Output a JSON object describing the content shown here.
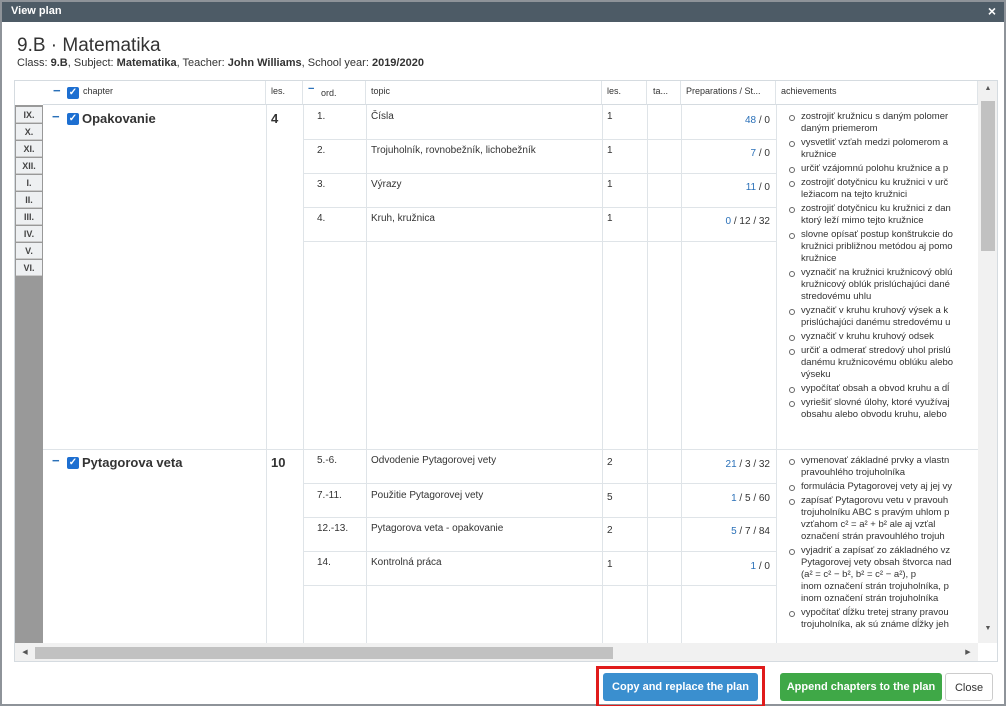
{
  "window": {
    "title": "View plan",
    "close_glyph": "×"
  },
  "page": {
    "title": "9.B · Matematika",
    "meta": {
      "class_label": "Class: ",
      "class_value": "9.B",
      "subject_label": ", Subject: ",
      "subject_value": "Matematika",
      "teacher_label": ", Teacher: ",
      "teacher_value": "John Williams",
      "year_label": ", School year: ",
      "year_value": "2019/2020"
    }
  },
  "columns": {
    "chapter": "chapter",
    "les": "les.",
    "ord": "ord.",
    "topic": "topic",
    "les2": "les.",
    "ta": "ta...",
    "prep": "Preparations / St...",
    "ach": "achievements"
  },
  "grade_tabs": [
    "IX.",
    "X.",
    "XI.",
    "XII.",
    "I.",
    "II.",
    "III.",
    "IV.",
    "V.",
    "VI."
  ],
  "chapters": [
    {
      "name": "Opakovanie",
      "lessons": "4",
      "topics": [
        {
          "ord": "1.",
          "topic": "Čísla",
          "les": "1",
          "prep_link": "48",
          "prep_rest": " / 0"
        },
        {
          "ord": "2.",
          "topic": "Trojuholník, rovnobežník, lichobežník",
          "les": "1",
          "prep_link": "7",
          "prep_rest": " / 0"
        },
        {
          "ord": "3.",
          "topic": "Výrazy",
          "les": "1",
          "prep_link": "11",
          "prep_rest": " / 0"
        },
        {
          "ord": "4.",
          "topic": "Kruh, kružnica",
          "les": "1",
          "prep_link": "0",
          "prep_rest": " / 12 / 32"
        }
      ],
      "achievements": [
        "zostrojiť kružnicu s daným polomer",
        "daným priemerom",
        "vysvetliť vzťah medzi polomerom a",
        "kružnice",
        "určiť vzájomnú polohu kružnice a p",
        "zostrojiť dotyčnicu ku kružnici v urč",
        "ležiacom na tejto kružnici",
        "zostrojiť dotyčnicu ku kružnici z dan",
        "ktorý leží mimo tejto kružnice",
        "slovne opísať postup konštrukcie do",
        "kružnici približnou metódou aj pomo",
        "kružnice",
        "vyznačiť na kružnici kružnicový oblú",
        "kružnicový oblúk prislúchajúci dané",
        "stredovému uhlu",
        "vyznačiť v kruhu kruhový výsek a k",
        "prislúchajúci danému stredovému u",
        "vyznačiť v kruhu kruhový odsek",
        "určiť a odmerať stredový uhol prislú",
        "danému kružnicovému oblúku alebo",
        "výseku",
        "vypočítať obsah a obvod kruhu a dĺ",
        "vyriešiť slovné úlohy, ktoré využívaj",
        "obsahu alebo obvodu kruhu, alebo"
      ]
    },
    {
      "name": "Pytagorova veta",
      "lessons": "10",
      "topics": [
        {
          "ord": "5.-6.",
          "topic": "Odvodenie Pytagorovej vety",
          "les": "2",
          "prep_link": "21",
          "prep_rest": " / 3 / 32"
        },
        {
          "ord": "7.-11.",
          "topic": "Použitie Pytagorovej vety",
          "les": "5",
          "prep_link": "1",
          "prep_rest": " / 5 / 60"
        },
        {
          "ord": "12.-13.",
          "topic": "Pytagorova veta - opakovanie",
          "les": "2",
          "prep_link": "5",
          "prep_rest": " / 7 / 84"
        },
        {
          "ord": "14.",
          "topic": "Kontrolná práca",
          "les": "1",
          "prep_link": "1",
          "prep_rest": " / 0"
        }
      ],
      "achievements": [
        "vymenovať základné prvky a vlastn",
        "pravouhlého trojuholníka",
        "formulácia Pytagorovej vety aj jej vy",
        "zapísať Pytagorovu vetu v pravouh",
        "trojuholníku ABC s pravým uhlom p",
        "vzťahom c² = a² + b² ale aj vzťal",
        "označení strán pravouhlého trojuh",
        "vyjadriť a zapísať zo základného vz",
        "Pytagorovej vety obsah štvorca nad",
        "(a² = c² − b², b² = c² − a²), p",
        "inom označení strán trojuholníka, p",
        "inom označení strán trojuholníka",
        "vypočítať dĺžku tretej strany pravou",
        "trojuholníka, ak sú známe dĺžky jeh"
      ]
    }
  ],
  "buttons": {
    "copy": "Copy and replace the plan",
    "append": "Append chapters to the plan",
    "close": "Close"
  },
  "colors": {
    "titlebar": "#4d5b66",
    "copy_button": "#3a8fcf",
    "append_button": "#3fa847",
    "highlight": "#e01b1b",
    "link": "#2a70b8"
  }
}
